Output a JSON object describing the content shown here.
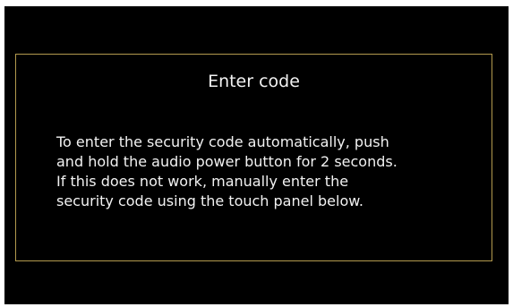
{
  "colors": {
    "screen_background": "#000000",
    "dialog_border": "#b39a4e",
    "text": "#f2f2f2"
  },
  "dialog": {
    "title": "Enter code",
    "message_lines": [
      "To enter the security code automatically, push",
      "and hold the audio power button for 2 seconds.",
      "If this does not work, manually enter the",
      "security code using the touch panel below."
    ]
  }
}
